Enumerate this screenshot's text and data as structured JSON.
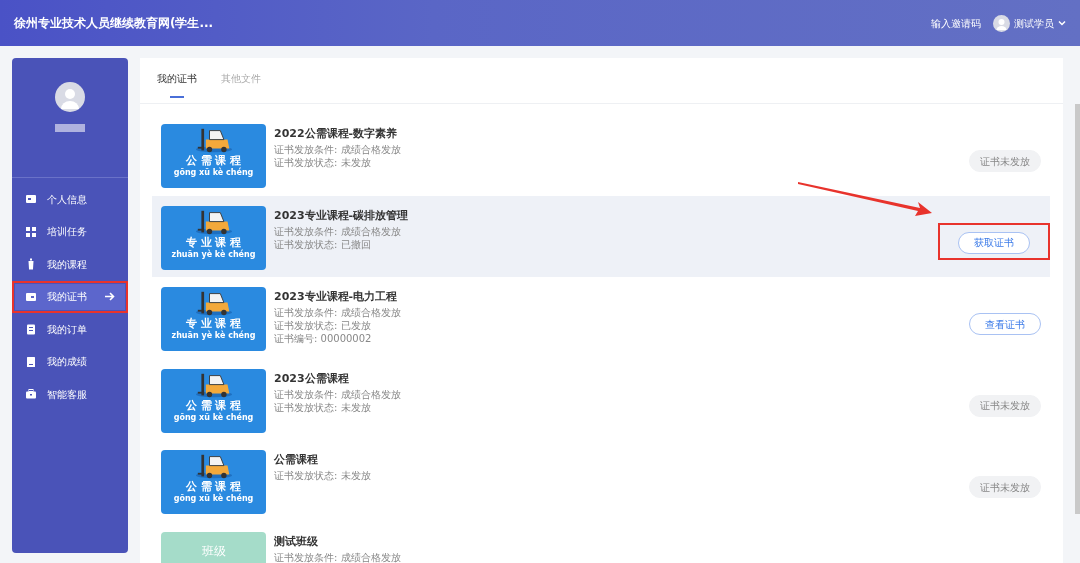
{
  "header": {
    "title": "徐州专业技术人员继续教育网(学生...",
    "invite": "输入邀请码",
    "user": "测试学员"
  },
  "sidebar": {
    "items": [
      {
        "label": "个人信息",
        "selected": false,
        "highlighted": false
      },
      {
        "label": "培训任务",
        "selected": false,
        "highlighted": false
      },
      {
        "label": "我的课程",
        "selected": false,
        "highlighted": false
      },
      {
        "label": "我的证书",
        "selected": true,
        "highlighted": true
      },
      {
        "label": "我的订单",
        "selected": false,
        "highlighted": false
      },
      {
        "label": "我的成绩",
        "selected": false,
        "highlighted": false
      },
      {
        "label": "智能客服",
        "selected": false,
        "highlighted": false
      }
    ]
  },
  "tabs": [
    {
      "label": "我的证书",
      "selected": true
    },
    {
      "label": "其他文件",
      "selected": false
    }
  ],
  "certificates": [
    {
      "thumb": {
        "kind": "course",
        "label": "公 需 课 程",
        "pinyin": "gōng xū kè chéng"
      },
      "title": "2022公需课程-数字素养",
      "lines": [
        "证书发放条件: 成绩合格发放",
        "证书发放状态: 未发放"
      ],
      "hovered": false,
      "button": {
        "kind": "disabled",
        "label": "证书未发放",
        "highlighted": false
      }
    },
    {
      "thumb": {
        "kind": "course",
        "label": "专 业 课 程",
        "pinyin": "zhuān yè kè chéng"
      },
      "title": "2023专业课程-碳排放管理",
      "lines": [
        "证书发放条件: 成绩合格发放",
        "证书发放状态: 已撤回"
      ],
      "hovered": true,
      "button": {
        "kind": "action",
        "label": "获取证书",
        "highlighted": true
      }
    },
    {
      "thumb": {
        "kind": "course",
        "label": "专 业 课 程",
        "pinyin": "zhuān yè kè chéng"
      },
      "title": "2023专业课程-电力工程",
      "lines": [
        "证书发放条件: 成绩合格发放",
        "证书发放状态: 已发放",
        "证书编号: 00000002"
      ],
      "hovered": false,
      "button": {
        "kind": "action",
        "label": "查看证书",
        "highlighted": false
      }
    },
    {
      "thumb": {
        "kind": "course",
        "label": "公 需 课 程",
        "pinyin": "gōng xū kè chéng"
      },
      "title": "2023公需课程",
      "lines": [
        "证书发放条件: 成绩合格发放",
        "证书发放状态: 未发放"
      ],
      "hovered": false,
      "button": {
        "kind": "disabled",
        "label": "证书未发放",
        "highlighted": false
      }
    },
    {
      "thumb": {
        "kind": "course",
        "label": "公 需 课 程",
        "pinyin": "gōng xū kè chéng"
      },
      "title": "公需课程",
      "lines": [
        "证书发放状态: 未发放"
      ],
      "hovered": false,
      "button": {
        "kind": "disabled",
        "label": "证书未发放",
        "highlighted": false
      }
    },
    {
      "thumb": {
        "kind": "class",
        "label": "班级"
      },
      "title": "测试班级",
      "lines": [
        "证书发放条件: 成绩合格发放"
      ],
      "hovered": false
    }
  ]
}
